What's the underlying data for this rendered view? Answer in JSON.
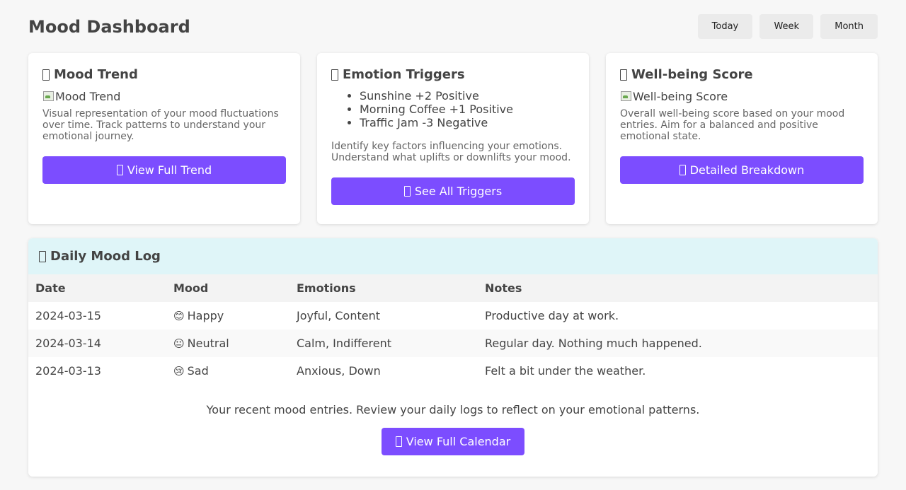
{
  "header": {
    "title": "Mood Dashboard",
    "range_buttons": [
      "Today",
      "Week",
      "Month"
    ]
  },
  "cards": {
    "mood_trend": {
      "title": "Mood Trend",
      "image_alt": "Mood Trend",
      "description": "Visual representation of your mood fluctuations over time. Track patterns to understand your emotional journey.",
      "button": "View Full Trend"
    },
    "emotion_triggers": {
      "title": "Emotion Triggers",
      "triggers": [
        "Sunshine +2 Positive",
        "Morning Coffee +1 Positive",
        "Traffic Jam -3 Negative"
      ],
      "description": "Identify key factors influencing your emotions. Understand what uplifts or downlifts your mood.",
      "button": "See All Triggers"
    },
    "wellbeing": {
      "title": "Well-being Score",
      "image_alt": "Well-being Score",
      "description": "Overall well-being score based on your mood entries. Aim for a balanced and positive emotional state.",
      "button": "Detailed Breakdown"
    }
  },
  "log": {
    "title": "Daily Mood Log",
    "columns": [
      "Date",
      "Mood",
      "Emotions",
      "Notes"
    ],
    "rows": [
      {
        "date": "2024-03-15",
        "mood_emoji": "😊",
        "mood": "Happy",
        "emotions": "Joyful, Content",
        "notes": "Productive day at work."
      },
      {
        "date": "2024-03-14",
        "mood_emoji": "😐",
        "mood": "Neutral",
        "emotions": "Calm, Indifferent",
        "notes": "Regular day. Nothing much happened."
      },
      {
        "date": "2024-03-13",
        "mood_emoji": "😢",
        "mood": "Sad",
        "emotions": "Anxious, Down",
        "notes": "Felt a bit under the weather."
      }
    ],
    "footer_text": "Your recent mood entries. Review your daily logs to reflect on your emotional patterns.",
    "button": "View Full Calendar"
  },
  "colors": {
    "accent": "#7c4dff",
    "log_header_bg": "#dff5f8",
    "page_bg": "#f7f7f7"
  }
}
